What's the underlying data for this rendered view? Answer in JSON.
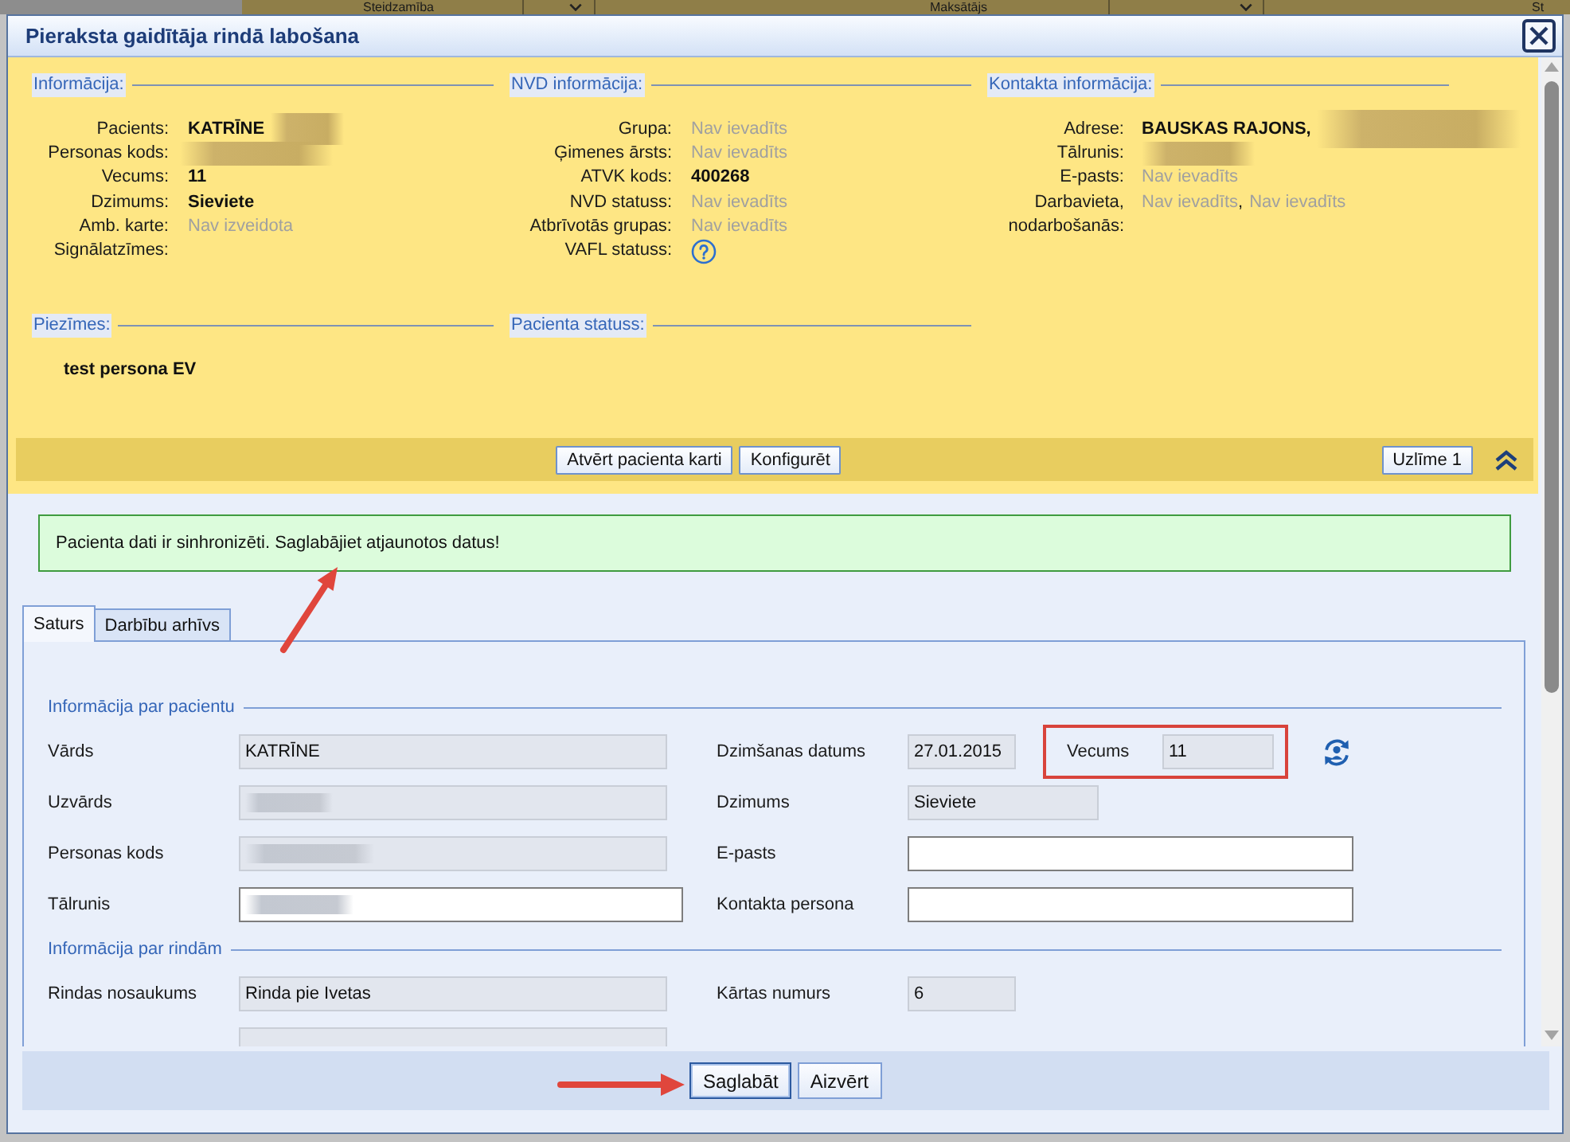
{
  "background_table": {
    "columns": [
      {
        "label": "Steidzamība",
        "dropdown": true
      },
      {
        "label": "Maksātājs",
        "dropdown": true
      },
      {
        "label": "St"
      }
    ]
  },
  "window": {
    "title": "Pieraksta gaidītāja rindā labošana"
  },
  "patient_info": {
    "expanded": true,
    "sections": [
      {
        "title": "Informācija:",
        "fields": [
          {
            "label": "Pacients:",
            "parts": [
              {
                "kind": "bold",
                "text": "KATRĪNE"
              },
              {
                "kind": "redacted"
              }
            ]
          },
          {
            "label": "Personas kods:",
            "parts": [
              {
                "kind": "redacted"
              }
            ]
          },
          {
            "label": "Vecums:",
            "parts": [
              {
                "kind": "bold",
                "text": "11"
              }
            ]
          },
          {
            "label": "Dzimums:",
            "parts": [
              {
                "kind": "bold",
                "text": "Sieviete"
              }
            ]
          },
          {
            "label": "Amb. karte:",
            "parts": [
              {
                "kind": "muted",
                "text": "Nav izveidota"
              }
            ]
          },
          {
            "label": "Signālatzīmes:"
          }
        ]
      },
      {
        "title": "NVD informācija:",
        "fields": [
          {
            "label": "Grupa:",
            "parts": [
              {
                "kind": "muted",
                "text": "Nav ievadīts"
              }
            ]
          },
          {
            "label": "Ģimenes ārsts:",
            "parts": [
              {
                "kind": "muted",
                "text": "Nav ievadīts"
              }
            ]
          },
          {
            "label": "ATVK kods:",
            "parts": [
              {
                "kind": "bold",
                "text": "400268"
              }
            ]
          },
          {
            "label": "NVD statuss:",
            "parts": [
              {
                "kind": "muted",
                "text": "Nav ievadīts"
              }
            ]
          },
          {
            "label": "Atbrīvotās grupas:",
            "parts": [
              {
                "kind": "muted",
                "text": "Nav ievadīts"
              }
            ]
          },
          {
            "label": "VAFL statuss:",
            "parts": [
              {
                "kind": "help"
              }
            ]
          }
        ]
      },
      {
        "title": "Kontakta informācija:",
        "fields": [
          {
            "label": "Adrese:",
            "parts": [
              {
                "kind": "bold",
                "text": "BAUSKAS RAJONS,"
              },
              {
                "kind": "redacted"
              }
            ]
          },
          {
            "label": "Tālrunis:",
            "parts": [
              {
                "kind": "redacted"
              }
            ]
          },
          {
            "label": "E-pasts:",
            "parts": [
              {
                "kind": "muted",
                "text": "Nav ievadīts"
              }
            ]
          },
          {
            "label": "Darbavieta,\nnodarbošanās:",
            "parts": [
              {
                "kind": "muted",
                "text": "Nav ievadīts"
              },
              {
                "kind": "plain",
                "text": ","
              },
              {
                "kind": "muted",
                "text": "Nav ievadīts"
              }
            ]
          }
        ]
      }
    ],
    "notes": [
      {
        "title": "Piezīmes:",
        "text": "test persona EV"
      },
      {
        "title": "Pacienta statuss:"
      }
    ],
    "actions": [
      {
        "label": "Atvērt pacienta karti"
      },
      {
        "label": "Konfigurēt"
      }
    ],
    "sticker": {
      "label": "Uzlīme 1"
    }
  },
  "message": {
    "kind": "success",
    "text": "Pacienta dati ir sinhronizēti. Saglabājiet atjaunotos datus!"
  },
  "tabs": [
    {
      "label": "Saturs",
      "selected": true
    },
    {
      "label": "Darbību arhīvs",
      "selected": false
    }
  ],
  "form": {
    "sections": [
      {
        "title": "Informācija par pacientu",
        "rows": [
          {
            "left": {
              "label": "Vārds",
              "kind": "readonly",
              "value": "KATRĪNE"
            },
            "right": {
              "label": "Dzimšanas datums",
              "kind": "readonly",
              "value": "27.01.2015"
            },
            "extra": {
              "label": "Vecums",
              "kind": "readonly",
              "value": "11",
              "highlighted": true
            }
          },
          {
            "left": {
              "label": "Uzvārds",
              "kind": "readonly",
              "redacted": true
            },
            "right": {
              "label": "Dzimums",
              "kind": "readonly",
              "value": "Sieviete"
            }
          },
          {
            "left": {
              "label": "Personas kods",
              "kind": "readonly",
              "redacted": true
            },
            "right": {
              "label": "E-pasts",
              "kind": "input"
            }
          },
          {
            "left": {
              "label": "Tālrunis",
              "kind": "input",
              "redacted": true
            },
            "right": {
              "label": "Kontakta persona",
              "kind": "input"
            }
          }
        ]
      },
      {
        "title": "Informācija par rindām",
        "rows": [
          {
            "left": {
              "label": "Rindas nosaukums",
              "kind": "readonly",
              "value": "Rinda pie Ivetas"
            },
            "right": {
              "label": "Kārtas numurs",
              "kind": "readonly",
              "value": "6"
            }
          },
          {
            "left": {
              "kind": "readonly"
            }
          }
        ]
      }
    ]
  },
  "footer": {
    "buttons": [
      {
        "label": "Saglabāt",
        "focused": true
      },
      {
        "label": "Aizvērt",
        "focused": false
      }
    ]
  }
}
